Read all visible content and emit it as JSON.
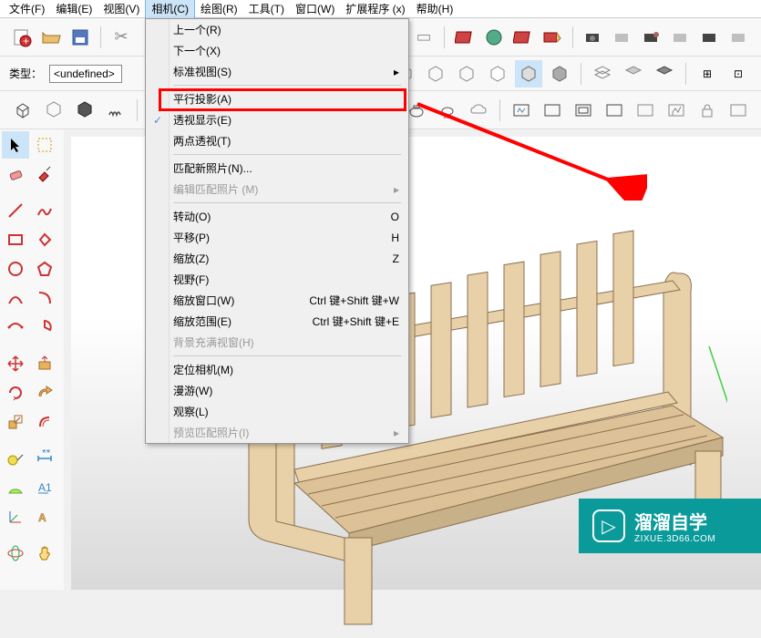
{
  "menubar": {
    "items": [
      {
        "label": "文件(F)"
      },
      {
        "label": "编辑(E)"
      },
      {
        "label": "视图(V)"
      },
      {
        "label": "相机(C)"
      },
      {
        "label": "绘图(R)"
      },
      {
        "label": "工具(T)"
      },
      {
        "label": "窗口(W)"
      },
      {
        "label": "扩展程序 (x)"
      },
      {
        "label": "帮助(H)"
      }
    ]
  },
  "type_row": {
    "label": "类型：",
    "value": "<undefined>"
  },
  "dropdown": {
    "items": [
      {
        "label": "上一个(R)",
        "shortcut": ""
      },
      {
        "label": "下一个(X)",
        "shortcut": ""
      },
      {
        "label": "标准视图(S)",
        "arrow": "▸"
      },
      {
        "sep": true
      },
      {
        "label": "平行投影(A)",
        "shortcut": ""
      },
      {
        "label": "透视显示(E)",
        "check": true
      },
      {
        "label": "两点透视(T)"
      },
      {
        "sep": true
      },
      {
        "label": "匹配新照片(N)..."
      },
      {
        "label": "编辑匹配照片 (M)",
        "arrow": "▸",
        "disabled": true
      },
      {
        "sep": true
      },
      {
        "label": "转动(O)",
        "shortcut": "O"
      },
      {
        "label": "平移(P)",
        "shortcut": "H"
      },
      {
        "label": "缩放(Z)",
        "shortcut": "Z"
      },
      {
        "label": "视野(F)"
      },
      {
        "label": "缩放窗口(W)",
        "shortcut": "Ctrl 键+Shift 键+W"
      },
      {
        "label": "缩放范围(E)",
        "shortcut": "Ctrl 键+Shift 键+E"
      },
      {
        "label": "背景充满视窗(H)",
        "disabled": true
      },
      {
        "sep": true
      },
      {
        "label": "定位相机(M)"
      },
      {
        "label": "漫游(W)"
      },
      {
        "label": "观察(L)"
      },
      {
        "label": "预览匹配照片(I)",
        "arrow": "▸",
        "disabled": true
      }
    ]
  },
  "watermark": {
    "title": "溜溜自学",
    "url": "ZIXUE.3D66.COM"
  }
}
